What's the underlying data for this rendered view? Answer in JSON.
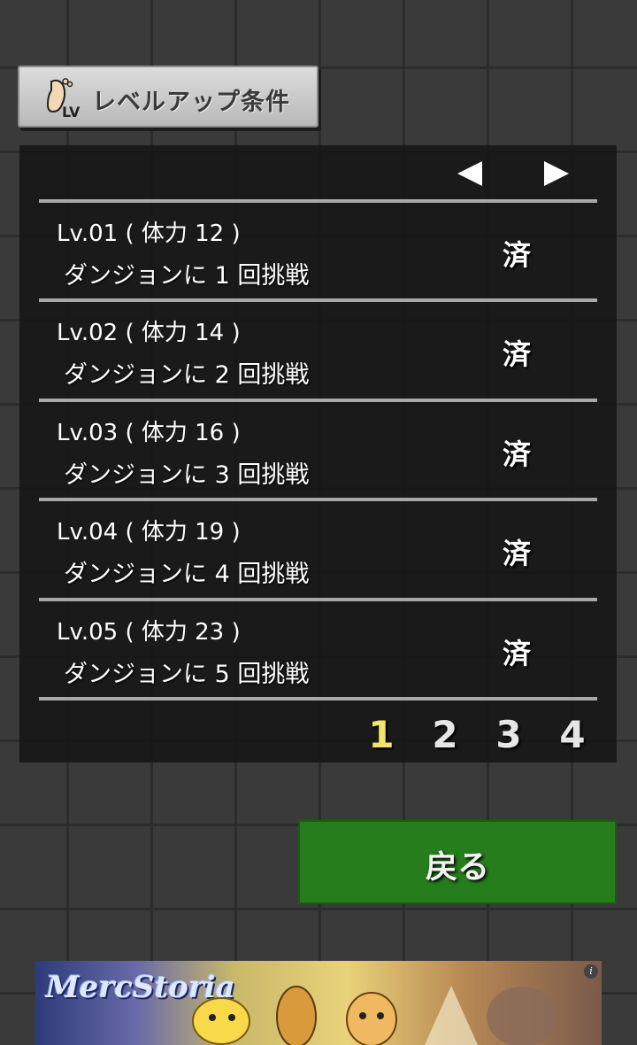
{
  "header": {
    "icon": "footprint-lv-icon",
    "title": "レベルアップ条件"
  },
  "nav": {
    "prev_icon": "triangle-left-icon",
    "next_icon": "triangle-right-icon"
  },
  "rows": [
    {
      "title": "Lv.01 ( 体力 12 )",
      "desc": "ダンジョンに 1 回挑戦",
      "status": "済"
    },
    {
      "title": "Lv.02 ( 体力 14 )",
      "desc": "ダンジョンに 2 回挑戦",
      "status": "済"
    },
    {
      "title": "Lv.03 ( 体力 16 )",
      "desc": "ダンジョンに 3 回挑戦",
      "status": "済"
    },
    {
      "title": "Lv.04 ( 体力 19 )",
      "desc": "ダンジョンに 4 回挑戦",
      "status": "済"
    },
    {
      "title": "Lv.05 ( 体力 23 )",
      "desc": "ダンジョンに 5 回挑戦",
      "status": "済"
    }
  ],
  "pagination": {
    "pages": [
      "1",
      "2",
      "3",
      "4"
    ],
    "active": "1",
    "active_color": "#f2e36a"
  },
  "back_button": {
    "label": "戻る",
    "color": "#267d1c"
  },
  "ad": {
    "logo": "MercStoria",
    "info_icon": "info-icon",
    "info_glyph": "i"
  }
}
